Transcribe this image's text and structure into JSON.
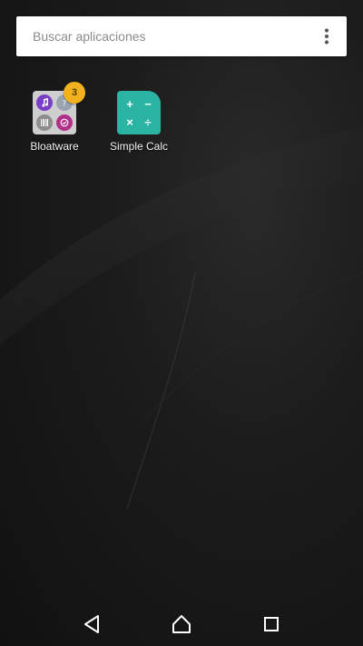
{
  "search": {
    "placeholder": "Buscar aplicaciones",
    "menu_icon": "overflow-menu-icon"
  },
  "apps": [
    {
      "label": "Bloatware",
      "type": "folder",
      "badge": "3",
      "icons": [
        "music-note-icon",
        "help-icon",
        "barcode-icon",
        "check-circle-icon"
      ]
    },
    {
      "label": "Simple Calc",
      "type": "app",
      "icon": "calculator-icon",
      "symbols": [
        "+",
        "−",
        "×",
        "÷"
      ]
    }
  ],
  "navigation": {
    "back_icon": "back-triangle-icon",
    "home_icon": "home-icon",
    "recents_icon": "recents-square-icon"
  },
  "colors": {
    "wallpaper": "#141414",
    "search_bg": "#ffffff",
    "badge": "#f2b21e",
    "calc_icon": "#2bb3a3",
    "label_text": "#f2f2f2"
  }
}
